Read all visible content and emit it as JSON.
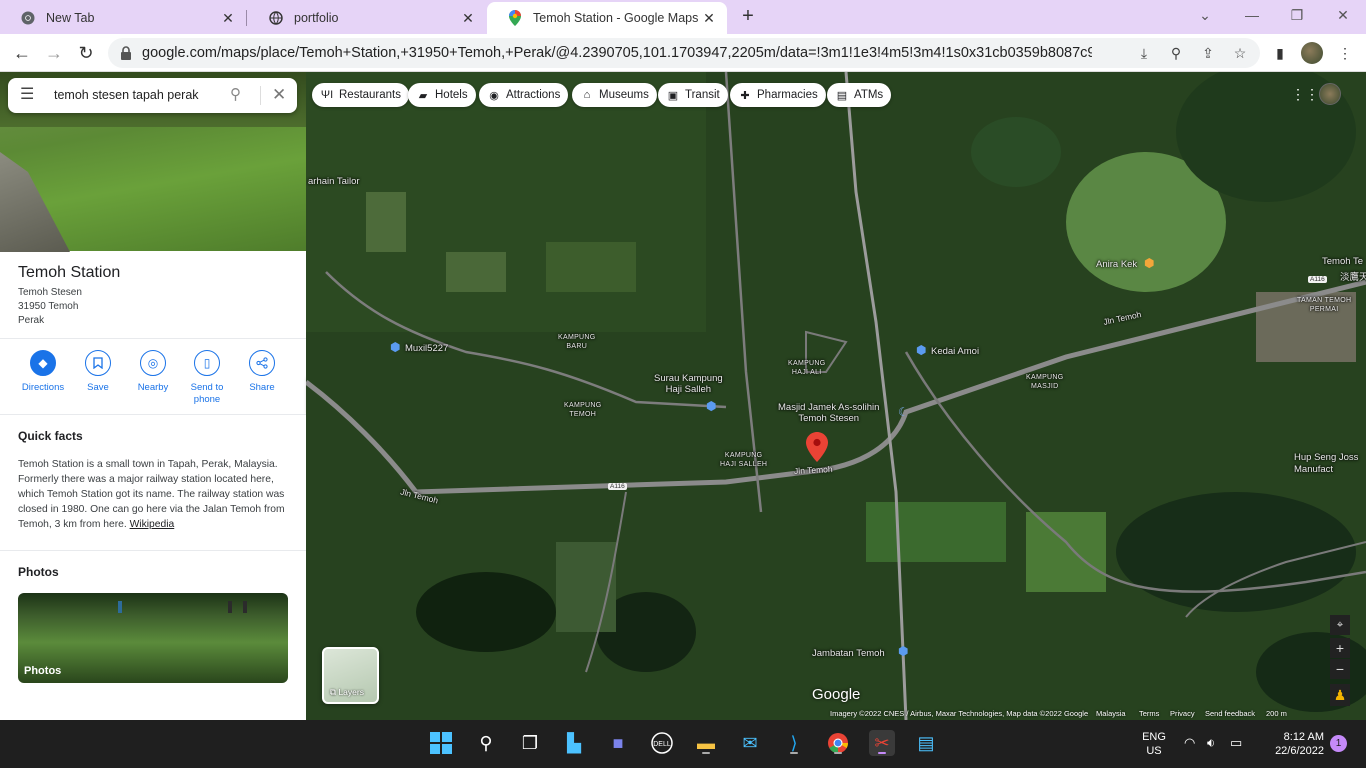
{
  "browser": {
    "tabs": [
      {
        "title": "New Tab",
        "icon": "chrome-icon"
      },
      {
        "title": "portfolio",
        "icon": "globe-icon"
      },
      {
        "title": "Temoh Station - Google Maps",
        "icon": "maps-pin-icon",
        "active": true
      }
    ],
    "url": "google.com/maps/place/Temoh+Station,+31950+Temoh,+Perak/@4.2390705,101.1703947,2205m/data=!3m1!1e3!4m5!3m4!1s0x31cb0359b8087c9d:0x4842..."
  },
  "search": {
    "query": "temoh stesen tapah perak"
  },
  "place": {
    "name": "Temoh Station",
    "address_lines": [
      "Temoh Stesen",
      "31950 Temoh",
      "Perak"
    ]
  },
  "actions": [
    {
      "label": "Directions",
      "icon": "directions-icon"
    },
    {
      "label": "Save",
      "icon": "bookmark-icon"
    },
    {
      "label": "Nearby",
      "icon": "nearby-icon"
    },
    {
      "label": "Send to phone",
      "icon": "send-to-phone-icon"
    },
    {
      "label": "Share",
      "icon": "share-icon"
    }
  ],
  "quick_facts": {
    "title": "Quick facts",
    "text": "Temoh Station is a small town in Tapah, Perak, Malaysia. Formerly there was a major railway station located here, which Temoh Station got its name. The railway station was closed in 1980. One can go here via the Jalan Temoh from Temoh, 3 km from here. ",
    "link": "Wikipedia"
  },
  "photos": {
    "title": "Photos",
    "label": "Photos"
  },
  "chips": [
    {
      "label": "Restaurants",
      "icon": "fork-knife-icon"
    },
    {
      "label": "Hotels",
      "icon": "bed-icon"
    },
    {
      "label": "Attractions",
      "icon": "camera-icon"
    },
    {
      "label": "Museums",
      "icon": "museum-icon"
    },
    {
      "label": "Transit",
      "icon": "train-icon"
    },
    {
      "label": "Pharmacies",
      "icon": "pharmacy-icon"
    },
    {
      "label": "ATMs",
      "icon": "atm-icon"
    }
  ],
  "map_labels": {
    "tailor": "arhain Tailor",
    "muxil": "Muxil5227",
    "kg_baru": "KAMPUNG\nBARU",
    "kg_temoh": "KAMPUNG\nTEMOH",
    "surau": "Surau Kampung\nHaji Salleh",
    "kg_haji_ali": "KAMPUNG\nHAJI ALI",
    "masjid": "Masjid Jamek As-solihin\nTemoh Stesen",
    "kg_haji_salleh": "KAMPUNG\nHAJI SALLEH",
    "jln_temoh_1": "Jln Temoh",
    "jln_temoh_2": "Jln Temoh",
    "jln_temoh_3": "Jln Temoh",
    "kedai": "Kedai Amoi",
    "kg_masjid": "KAMPUNG\nMASJID",
    "anira": "Anira Kek",
    "temoh_te": "Temoh Te",
    "chinese": "淡鷹天",
    "taman": "TAMAN TEMOH\nPERMAI",
    "hup_seng": "Hup Seng Joss\nManufact",
    "jambatan": "Jambatan Temoh",
    "road_a116_1": "A116",
    "road_a116_2": "A116",
    "google": "Google",
    "layers": "Layers"
  },
  "attribution": {
    "imagery": "Imagery ©2022 CNES / Airbus, Maxar Technologies, Map data ©2022 Google",
    "country": "Malaysia",
    "terms": "Terms",
    "privacy": "Privacy",
    "feedback": "Send feedback",
    "scale": "200 m"
  },
  "tray": {
    "lang_top": "ENG",
    "lang_bottom": "US",
    "time": "8:12 AM",
    "date": "22/6/2022",
    "notifications": "1"
  },
  "colors": {
    "accent": "#1a73e8",
    "pin": "#ea4335",
    "tabbar": "#e6d4f7"
  }
}
